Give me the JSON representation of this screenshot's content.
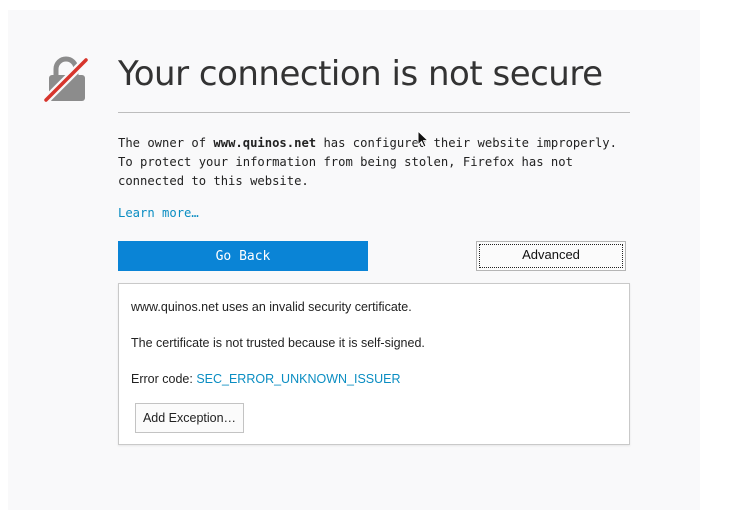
{
  "page": {
    "title": "Your connection is not secure",
    "description": {
      "before_host": "The owner of ",
      "host": "www.quinos.net",
      "after_host": " has configured their website improperly. To protect your information from being stolen, Firefox has not connected to this website."
    },
    "learn_more_label": "Learn more…",
    "go_back_label": "Go Back",
    "advanced_label": "Advanced"
  },
  "advanced_panel": {
    "invalid_cert_text": "www.quinos.net uses an invalid security certificate.",
    "reason_text": "The certificate is not trusted because it is self-signed.",
    "error_code_label": "Error code: ",
    "error_code_value": "SEC_ERROR_UNKNOWN_ISSUER",
    "add_exception_label": "Add Exception…"
  },
  "icons": {
    "lock": "broken-lock-icon",
    "cursor": "mouse-pointer-icon"
  },
  "colors": {
    "primary_button": "#0a84d6",
    "link": "#0a8dc2",
    "lock_strike": "#d7352c",
    "lock_body": "#8c8c8c"
  }
}
